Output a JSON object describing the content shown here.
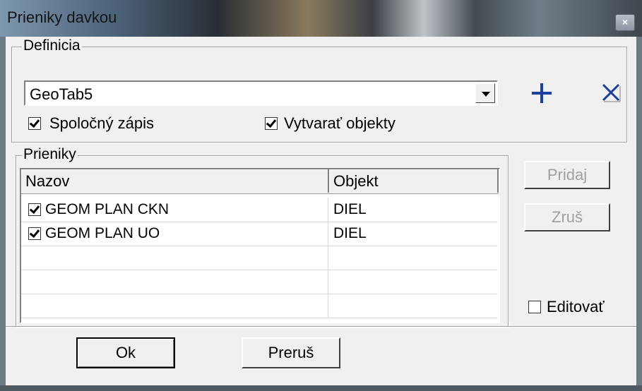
{
  "window": {
    "title": "Prieniky davkou",
    "close_label": "×"
  },
  "definicia": {
    "legend": "Definicia",
    "combo_value": "GeoTab5",
    "add_icon": "plus-icon",
    "delete_icon": "x-icon",
    "checkbox_spolocny": {
      "label": "Spoločný zápis",
      "checked": true
    },
    "checkbox_vytvarat": {
      "label": "Vytvarať objekty",
      "checked": true
    }
  },
  "prieniky": {
    "legend": "Prieniky",
    "columns": [
      "Nazov",
      "Objekt"
    ],
    "rows": [
      {
        "nazov": "GEOM PLAN CKN",
        "objekt": "DIEL",
        "checked": true
      },
      {
        "nazov": "GEOM PLAN UO",
        "objekt": "DIEL",
        "checked": true
      },
      {
        "nazov": "",
        "objekt": "",
        "checked": false
      },
      {
        "nazov": "",
        "objekt": "",
        "checked": false
      },
      {
        "nazov": "",
        "objekt": "",
        "checked": false
      }
    ]
  },
  "side": {
    "pridaj_label": "Pridaj",
    "zrus_label": "Zruš",
    "editovat": {
      "label": "Editovať",
      "checked": false
    }
  },
  "footer": {
    "ok_label": "Ok",
    "prerus_label": "Preruš"
  },
  "colors": {
    "plus": "#1a3fa0",
    "x": "#1a3fa0",
    "disabled_text": "#a0a0a0"
  }
}
